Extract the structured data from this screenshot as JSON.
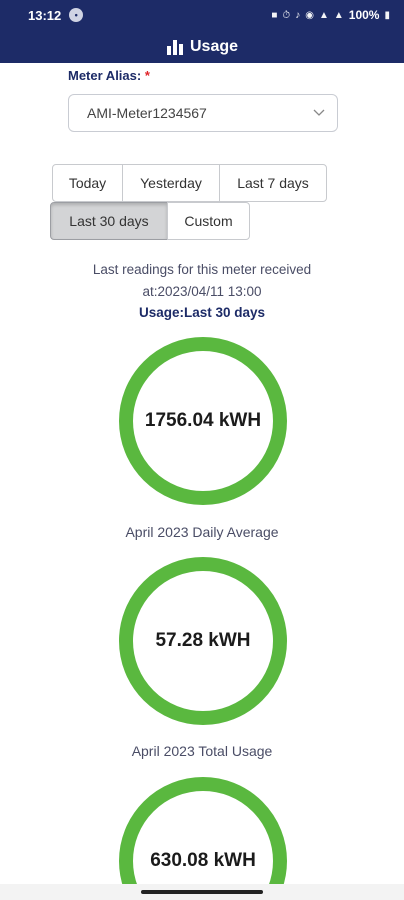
{
  "status_bar": {
    "time": "13:12",
    "battery": "100%"
  },
  "header": {
    "title": "Usage"
  },
  "meter": {
    "label": "Meter Alias:",
    "required_mark": "*",
    "selected": "AMI-Meter1234567"
  },
  "ranges": {
    "today": "Today",
    "yesterday": "Yesterday",
    "last7": "Last 7 days",
    "last30": "Last 30 days",
    "custom": "Custom",
    "active": "Last 30 days"
  },
  "summary": {
    "last_reading_line1": "Last readings for this meter received",
    "last_reading_line2": "at:2023/04/11 13:00",
    "usage_title": "Usage:Last 30 days"
  },
  "cards": [
    {
      "value": "1756.04 kWH",
      "caption": "April 2023 Daily Average"
    },
    {
      "value": "57.28 kWH",
      "caption": "April 2023 Total Usage"
    },
    {
      "value": "630.08 kWH",
      "caption": ""
    }
  ],
  "colors": {
    "header_bg": "#1d2b67",
    "ring": "#5ab83f",
    "required": "#e0242a"
  }
}
